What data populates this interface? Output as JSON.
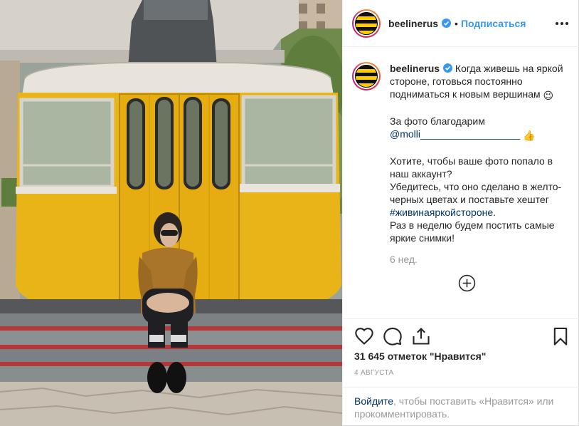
{
  "post": {
    "username": "beelinerus",
    "follow_label": "Подписаться",
    "separator": "•"
  },
  "caption": {
    "username": "beelinerus",
    "line1": "Когда живешь на яркой стороне, готовься постоянно подниматься к новым вершинам",
    "emoji1": "😉",
    "thanks": "За фото благодарим",
    "mention": "@molli__________________",
    "emoji2": "👍",
    "question": "Хотите, чтобы ваше фото попало в наш аккаунт?",
    "instruction": "Убедитесь, что оно сделано в желто-черных цветах и поставьте хештег",
    "hashtag": "#живинаяркойстороне",
    "period": ".",
    "weekly": "Раз в неделю будем постить самые яркие снимки!",
    "time_ago": "6 нед."
  },
  "stats": {
    "likes": "31 645 отметок \"Нравится\"",
    "date": "4 августа"
  },
  "login_prompt": {
    "link": "Войдите",
    "text": ", чтобы поставить «Нравится» или прокомментировать."
  },
  "icons": {
    "verified": "verified-badge-icon",
    "more": "more-options-icon",
    "load_more": "load-more-comments-icon",
    "like": "heart-icon",
    "comment": "comment-icon",
    "share": "share-icon",
    "save": "bookmark-icon"
  },
  "colors": {
    "link_blue": "#3897f0",
    "dark_link": "#003569",
    "muted": "#999999",
    "cabin_yellow": "#e8b418"
  }
}
